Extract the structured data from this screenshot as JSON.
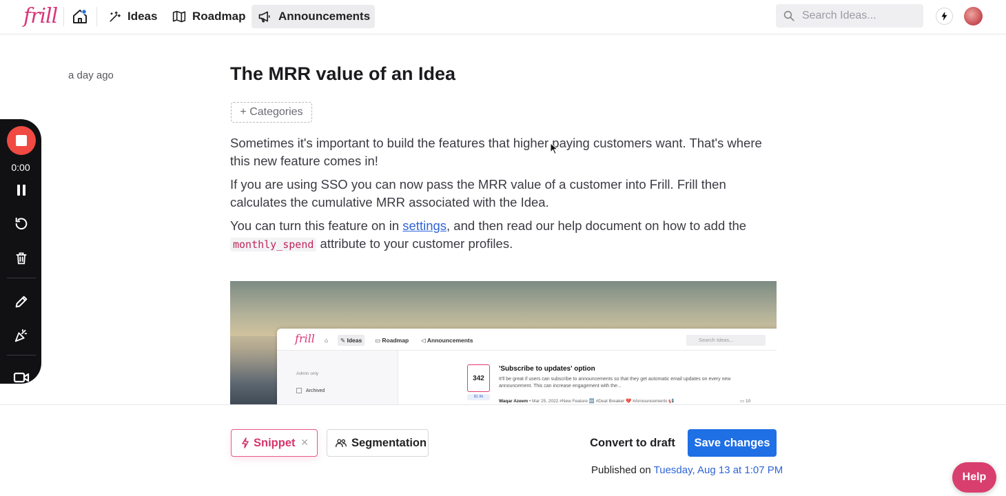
{
  "brand": {
    "logo_text": "frill",
    "accent": "#d9367a",
    "primary": "#1f6fe5"
  },
  "nav": {
    "items": [
      {
        "label": "Ideas",
        "icon": "magic-wand-icon"
      },
      {
        "label": "Roadmap",
        "icon": "map-icon"
      },
      {
        "label": "Announcements",
        "icon": "megaphone-icon",
        "active": true
      }
    ],
    "search_placeholder": "Search Ideas..."
  },
  "recorder": {
    "time": "0:00"
  },
  "article": {
    "date": "a day ago",
    "title": "The MRR value of an Idea",
    "categories_label": "+ Categories",
    "p1": "Sometimes it's important to build the features that higher paying customers want. That's where this new feature comes in!",
    "p2": "If you are using SSO you can now pass the MRR value of a customer into Frill. Frill then calculates the cumulative MRR associated with the Idea.",
    "p3_before": "You can turn this feature on in ",
    "p3_link": "settings",
    "p3_after": ", and then read our help document on how to add the",
    "p3_code": "monthly_spend",
    "p3_end": " attribute to your customer profiles."
  },
  "embedded": {
    "logo_text": "frill",
    "nav": [
      "Ideas",
      "Roadmap",
      "Announcements"
    ],
    "search_placeholder": "Search Ideas...",
    "sidebar_admin": "Admin only",
    "sidebar_archived": "Archived",
    "vote_count": "342",
    "mrr": "$1.9k",
    "idea_title": "'Subscribe to updates' option",
    "idea_body": "It'll be great if users can subscribe to announcements so that they get automatic email updates on every new announcement. This can increase engagement with the...",
    "author": "Waqar Azeem",
    "meta": "• Mar 25, 2022 #New Feature 🆕 #Deal Breaker 💔 #Announcements 📢",
    "comments": "10"
  },
  "footer": {
    "snippet_label": "Snippet",
    "segmentation_label": "Segmentation",
    "draft_label": "Convert to draft",
    "save_label": "Save changes",
    "published_prefix": "Published on ",
    "published_date": "Tuesday, Aug 13 at 1:07 PM",
    "help_label": "Help"
  }
}
